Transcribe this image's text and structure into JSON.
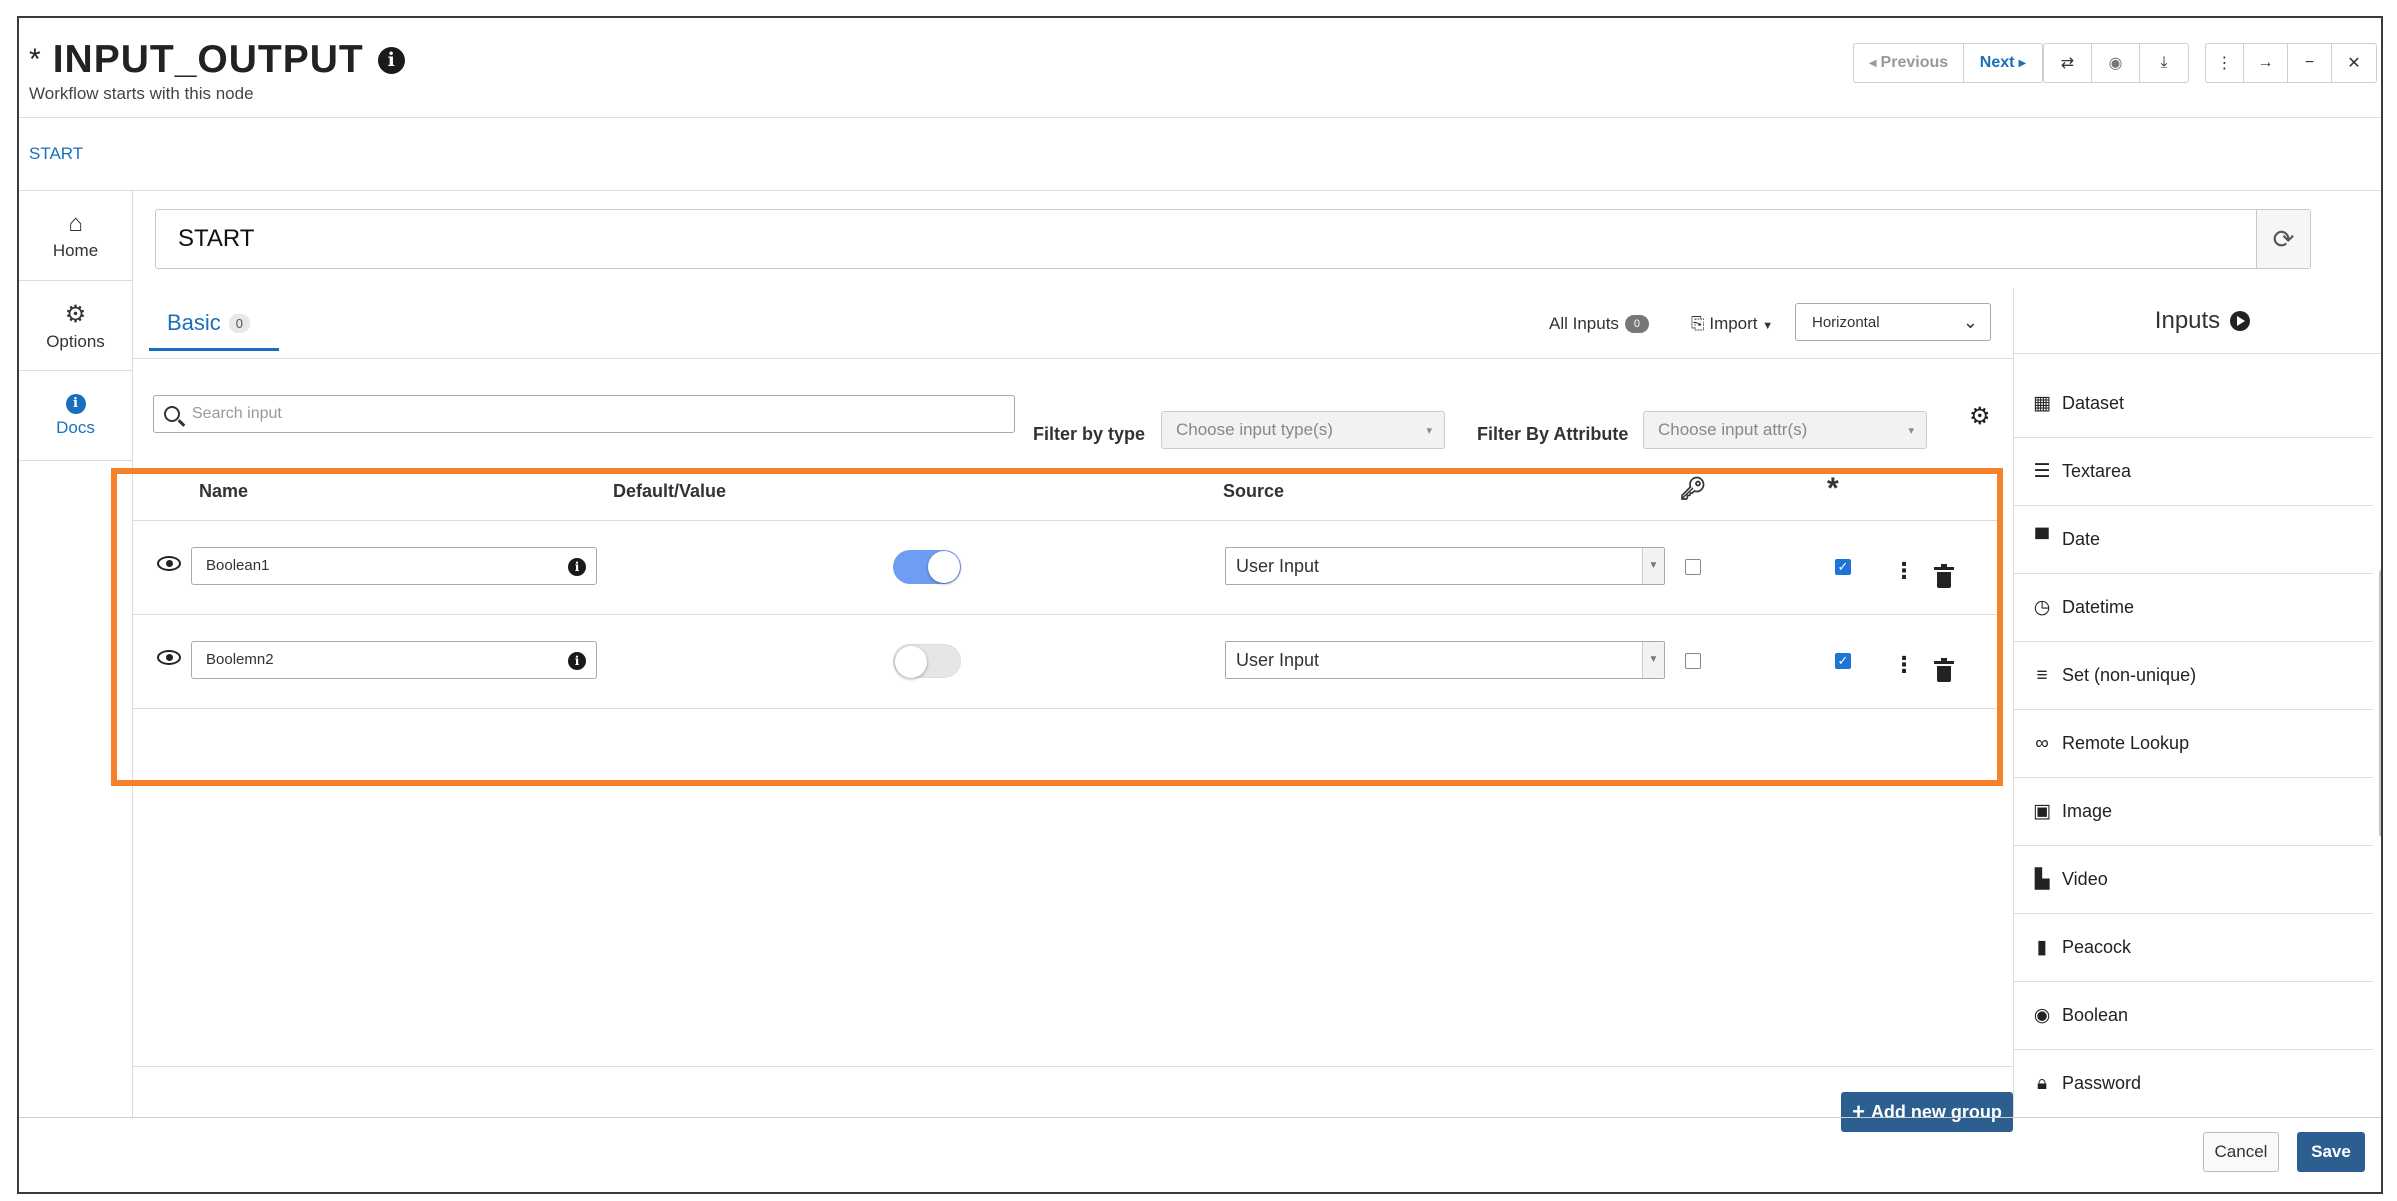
{
  "header": {
    "modified_marker": "*",
    "title": "INPUT_OUTPUT",
    "subtitle": "Workflow starts with this node",
    "prev_label": "Previous",
    "next_label": "Next"
  },
  "breadcrumb": "START",
  "sidebar": {
    "items": [
      {
        "label": "Home",
        "icon": "home-icon"
      },
      {
        "label": "Options",
        "icon": "gear-icon"
      },
      {
        "label": "Docs",
        "icon": "info-icon"
      }
    ]
  },
  "node_name": "START",
  "tabs": {
    "basic_label": "Basic",
    "basic_count": "0",
    "all_inputs_label": "All Inputs",
    "all_inputs_count": "0",
    "import_label": "Import",
    "layout_value": "Horizontal"
  },
  "filters": {
    "search_placeholder": "Search input",
    "type_label": "Filter by type",
    "type_placeholder": "Choose input type(s)",
    "attr_label": "Filter By Attribute",
    "attr_placeholder": "Choose input attr(s)"
  },
  "table": {
    "columns": {
      "name": "Name",
      "default": "Default/Value",
      "source": "Source",
      "required": "*"
    },
    "rows": [
      {
        "name": "Boolean1",
        "value": true,
        "source": "User Input",
        "key": false,
        "required": true
      },
      {
        "name": "Boolemn2",
        "value": false,
        "source": "User Input",
        "key": false,
        "required": true
      }
    ]
  },
  "add_group_label": "Add new group",
  "inputs_panel": {
    "title": "Inputs",
    "items": [
      {
        "label": "Dataset",
        "icon": "table-icon"
      },
      {
        "label": "Textarea",
        "icon": "text-lines-icon"
      },
      {
        "label": "Date",
        "icon": "calendar-icon"
      },
      {
        "label": "Datetime",
        "icon": "clock-icon"
      },
      {
        "label": "Set (non-unique)",
        "icon": "list-icon"
      },
      {
        "label": "Remote Lookup",
        "icon": "link-icon"
      },
      {
        "label": "Image",
        "icon": "image-icon"
      },
      {
        "label": "Video",
        "icon": "video-file-icon"
      },
      {
        "label": "Peacock",
        "icon": "file-icon"
      },
      {
        "label": "Boolean",
        "icon": "toggle-icon"
      },
      {
        "label": "Password",
        "icon": "lock-icon"
      }
    ]
  },
  "footer": {
    "cancel_label": "Cancel",
    "save_label": "Save"
  }
}
